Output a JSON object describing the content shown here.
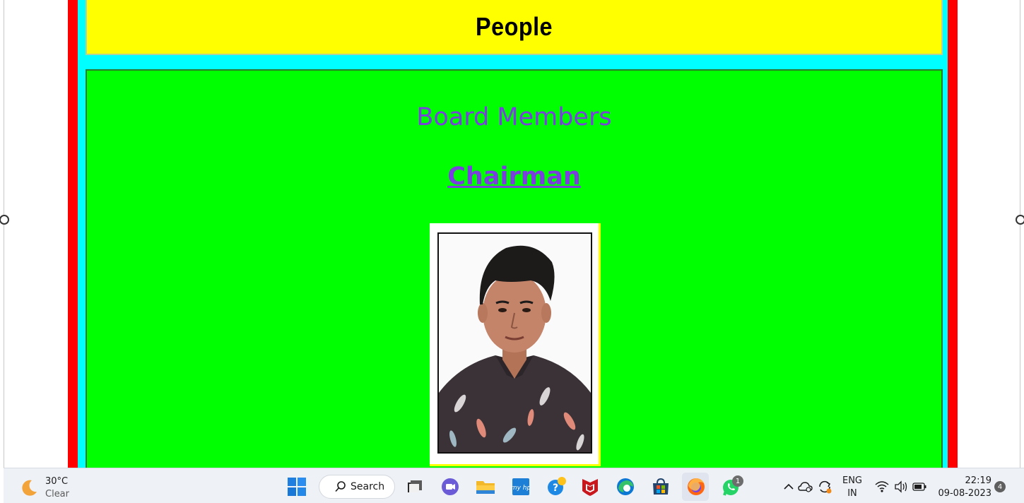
{
  "page": {
    "heading": "People",
    "section_title": "Board Members",
    "role_title": "Chairman"
  },
  "colors": {
    "outer_frame": "#ff0000",
    "inner_frame": "#00ffff",
    "header_bg": "#ffff00",
    "panel_bg": "#00ff00",
    "title_text": "#7b3fe0"
  },
  "taskbar": {
    "weather": {
      "temp": "30°C",
      "condition": "Clear",
      "icon": "moon-icon"
    },
    "search_label": "Search",
    "apps": [
      {
        "name": "windows-start-icon"
      },
      {
        "name": "task-view-icon"
      },
      {
        "name": "teams-chat-icon"
      },
      {
        "name": "file-explorer-icon"
      },
      {
        "name": "myhp-icon"
      },
      {
        "name": "get-help-icon"
      },
      {
        "name": "mcafee-icon"
      },
      {
        "name": "edge-browser-icon"
      },
      {
        "name": "microsoft-store-icon"
      },
      {
        "name": "firefox-icon"
      },
      {
        "name": "whatsapp-icon"
      }
    ],
    "whatsapp_badge": "1",
    "language": {
      "line1": "ENG",
      "line2": "IN"
    },
    "clock": {
      "time": "22:19",
      "date": "09-08-2023"
    },
    "notification_count": "4"
  }
}
